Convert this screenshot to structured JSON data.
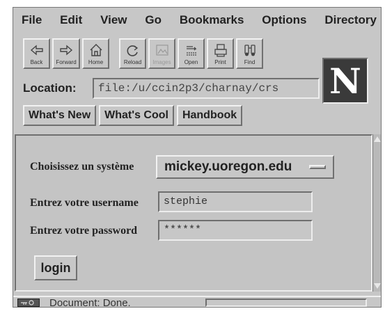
{
  "menu": {
    "items": [
      "File",
      "Edit",
      "View",
      "Go",
      "Bookmarks",
      "Options",
      "Directory"
    ]
  },
  "toolbar": {
    "buttons": [
      {
        "label": "Back",
        "icon": "back-arrow-icon"
      },
      {
        "label": "Forward",
        "icon": "forward-arrow-icon"
      },
      {
        "label": "Home",
        "icon": "home-icon"
      },
      {
        "label": "Reload",
        "icon": "reload-icon"
      },
      {
        "label": "Images",
        "icon": "images-icon",
        "disabled": true
      },
      {
        "label": "Open",
        "icon": "open-icon"
      },
      {
        "label": "Print",
        "icon": "print-icon"
      },
      {
        "label": "Find",
        "icon": "find-icon"
      }
    ]
  },
  "logo": {
    "letter": "N"
  },
  "location": {
    "label": "Location:",
    "value": "file:/u/ccin2p3/charnay/crs"
  },
  "directory_buttons": [
    "What's New",
    "What's Cool",
    "Handbook"
  ],
  "form": {
    "system_label": "Choisissez un système",
    "system_value": "mickey.uoregon.edu",
    "username_label": "Entrez votre username",
    "username_value": "stephie",
    "password_label": "Entrez votre password",
    "password_value": "******",
    "login_label": "login"
  },
  "status": {
    "text": "Document: Done."
  },
  "colors": {
    "chrome": "#c7c7c7",
    "logo_bg": "#3a3a3a"
  }
}
